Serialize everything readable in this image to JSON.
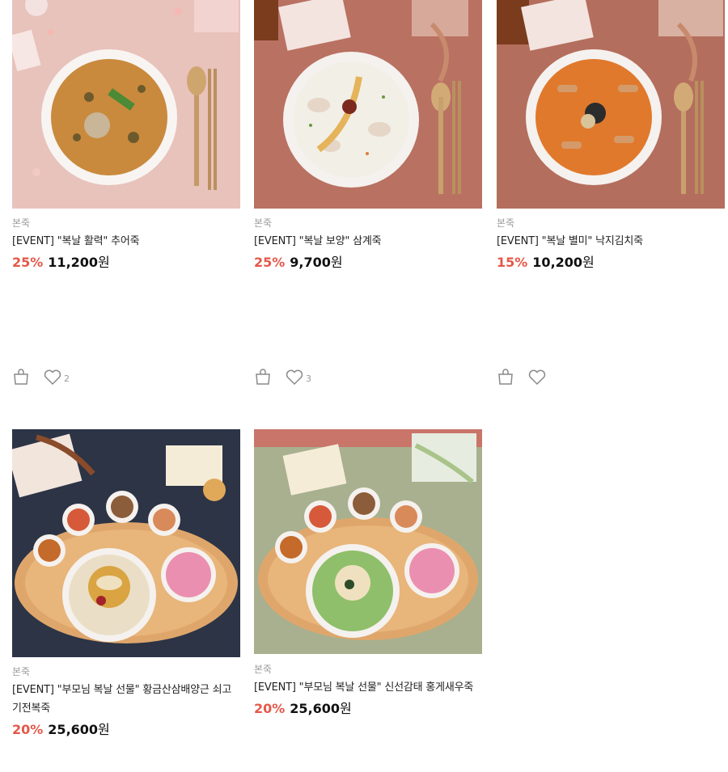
{
  "products": [
    {
      "brand": "본죽",
      "name": "[EVENT] \"복날 활력\" 추어죽",
      "discount": "25%",
      "price": "11,200",
      "currency": "원",
      "likes": "2",
      "image_icon": "chueo-porridge-image",
      "colors": {
        "bg": "#e7bfb7",
        "porridge": "#c98a3d"
      }
    },
    {
      "brand": "본죽",
      "name": "[EVENT] \"복날 보양\" 삼계죽",
      "discount": "25%",
      "price": "9,700",
      "currency": "원",
      "likes": "3",
      "image_icon": "samgye-porridge-image",
      "colors": {
        "bg": "#b97162",
        "porridge": "#f2efe6"
      }
    },
    {
      "brand": "본죽",
      "name": "[EVENT] \"복날 별미\" 낙지김치죽",
      "discount": "15%",
      "price": "10,200",
      "currency": "원",
      "likes": "",
      "image_icon": "octopus-kimchi-porridge-image",
      "colors": {
        "bg": "#b46e5d",
        "porridge": "#e0792c"
      }
    },
    {
      "brand": "본죽",
      "name": "[EVENT] \"부모님 복날 선물\" 황금산삼배양근 쇠고기전복죽",
      "discount": "20%",
      "price": "25,600",
      "currency": "원",
      "image_icon": "gift-set-beef-abalone-image",
      "colors": {
        "bg": "#2c3446",
        "porridge": "#eadfc6"
      }
    },
    {
      "brand": "본죽",
      "name": "[EVENT] \"부모님 복날 선물\" 신선감태 홍게새우죽",
      "discount": "20%",
      "price": "25,600",
      "currency": "원",
      "image_icon": "gift-set-crab-shrimp-image",
      "colors": {
        "bg": "#a8b08f",
        "porridge": "#8fbf6a"
      }
    }
  ],
  "icons": {
    "cart": "shopping-bag-icon",
    "like": "heart-icon"
  },
  "colors": {
    "discount": "#e4584a",
    "brand_text": "#9a9a9a"
  }
}
